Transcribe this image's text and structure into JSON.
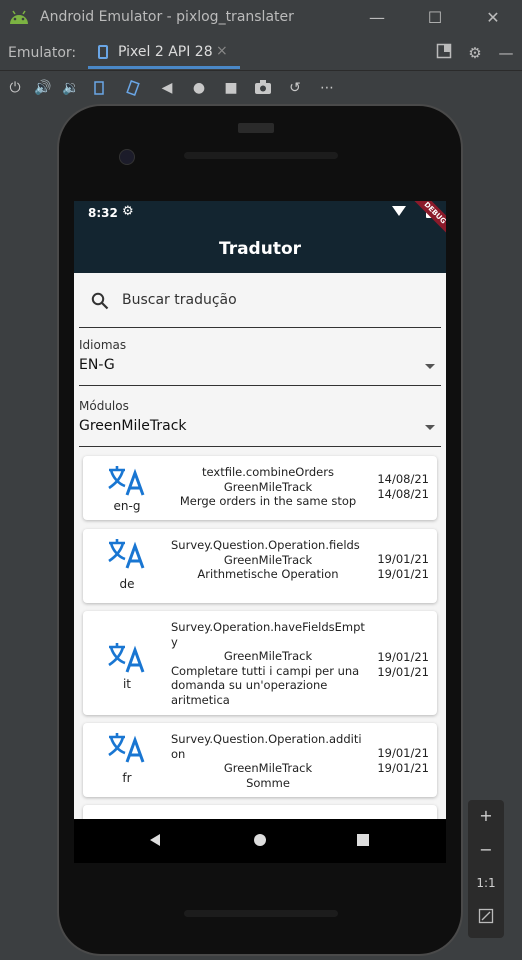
{
  "window": {
    "title": "Android Emulator - pixlog_translater"
  },
  "tabbar": {
    "label": "Emulator:",
    "device_tab": "Pixel 2 API 28",
    "close": "×"
  },
  "status": {
    "time": "8:32",
    "debug": "DEBUG"
  },
  "app": {
    "title": "Tradutor"
  },
  "search": {
    "placeholder": "Buscar tradução"
  },
  "idiomas": {
    "label": "Idiomas",
    "value": "EN-G"
  },
  "modulos": {
    "label": "Módulos",
    "value": "GreenMileTrack"
  },
  "cards": [
    {
      "lang": "en-g",
      "key": "textfile.combineOrders",
      "module": "GreenMileTrack",
      "text": "Merge orders in the same stop",
      "date1": "14/08/21",
      "date2": "14/08/21"
    },
    {
      "lang": "de",
      "key": "Survey.Question.Operation.fields",
      "module": "GreenMileTrack",
      "text": "Arithmetische Operation",
      "date1": "19/01/21",
      "date2": "19/01/21"
    },
    {
      "lang": "it",
      "key": "Survey.Operation.haveFieldsEmpty",
      "module": "GreenMileTrack",
      "text": "Completare tutti i campi per una domanda su un'operazione aritmetica",
      "date1": "19/01/21",
      "date2": "19/01/21"
    },
    {
      "lang": "fr",
      "key": "Survey.Question.Operation.addition",
      "module": "GreenMileTrack",
      "text": "Somme",
      "date1": "19/01/21",
      "date2": "19/01/21"
    }
  ],
  "side": {
    "zoom_in": "+",
    "zoom_out": "−",
    "ratio": "1:1"
  },
  "colors": {
    "appbar": "#132530",
    "icon_blue": "#1976d2",
    "debug_banner": "#8b1a2a"
  }
}
